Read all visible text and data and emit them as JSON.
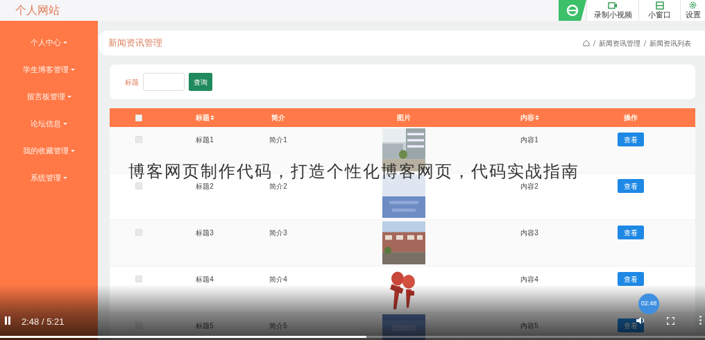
{
  "site_title": "个人网站",
  "recorder_toolbar": {
    "buttons": [
      {
        "label": "录制小视频",
        "kind": "record"
      },
      {
        "label": "小窗口",
        "kind": "window"
      },
      {
        "label": "设置",
        "kind": "settings"
      }
    ]
  },
  "sidebar": {
    "items": [
      {
        "label": "个人中心"
      },
      {
        "label": "学生博客管理"
      },
      {
        "label": "留言板管理"
      },
      {
        "label": "论坛信息"
      },
      {
        "label": "我的收藏管理"
      },
      {
        "label": "系统管理"
      }
    ]
  },
  "page_header": {
    "title": "新闻资讯管理",
    "breadcrumb": [
      "新闻资讯管理",
      "新闻资讯列表"
    ]
  },
  "search": {
    "label": "标题",
    "button": "查询"
  },
  "table": {
    "header_checked": false,
    "columns": [
      {
        "label": "标题",
        "sortable": true
      },
      {
        "label": "简介",
        "sortable": false
      },
      {
        "label": "图片",
        "sortable": false
      },
      {
        "label": "内容",
        "sortable": true
      },
      {
        "label": "操作",
        "sortable": false
      }
    ],
    "rows": [
      {
        "checked": false,
        "title": "标题1",
        "summary": "简介1",
        "content": "内容1",
        "action": "查看"
      },
      {
        "checked": false,
        "title": "标题2",
        "summary": "简介2",
        "content": "内容2",
        "action": "查看"
      },
      {
        "checked": false,
        "title": "标题3",
        "summary": "简介3",
        "content": "内容3",
        "action": "查看"
      },
      {
        "checked": false,
        "title": "标题4",
        "summary": "简介4",
        "content": "内容4",
        "action": "查看"
      },
      {
        "checked": false,
        "title": "标题5",
        "summary": "简介5",
        "content": "内容5",
        "action": "查看"
      }
    ]
  },
  "caption": "博客网页制作代码，打造个性化博客网页，代码实战指南",
  "player": {
    "playing": true,
    "time": "2:48 / 5:21",
    "bubble": "02:48",
    "level": 0.52
  }
}
